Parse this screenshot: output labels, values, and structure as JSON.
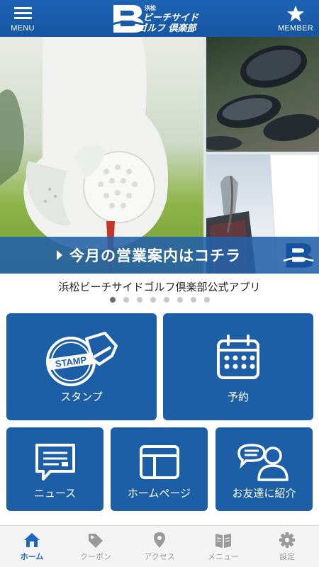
{
  "header": {
    "menu_label": "MENU",
    "member_label": "MEMBER",
    "logo": {
      "line0": "浜松",
      "line1": "ビーチサイド",
      "line2": "ゴルフ 倶楽部"
    }
  },
  "hero": {
    "caption": "今月の営業案内はコチラ"
  },
  "carousel": {
    "subtitle": "浜松ビーチサイドゴルフ倶楽部公式アプリ",
    "dot_count": 8,
    "active_index": 0
  },
  "tiles": {
    "stamp": {
      "label": "スタンプ",
      "icon_text": "STAMP"
    },
    "reserve": {
      "label": "予約"
    },
    "news": {
      "label": "ニュース"
    },
    "homepage": {
      "label": "ホームページ"
    },
    "invite": {
      "label": "お友達に紹介"
    }
  },
  "tabbar": {
    "tabs": [
      {
        "label": "ホーム",
        "icon": "home-icon"
      },
      {
        "label": "クーポン",
        "icon": "tag-icon"
      },
      {
        "label": "アクセス",
        "icon": "map-pin-icon"
      },
      {
        "label": "メニュー",
        "icon": "book-icon"
      },
      {
        "label": "設定",
        "icon": "gear-icon"
      }
    ],
    "active_index": 0
  },
  "colors": {
    "brand_blue": "#1d5fa7",
    "tab_active": "#1d66c2",
    "tab_inactive": "#9a9a9a"
  }
}
